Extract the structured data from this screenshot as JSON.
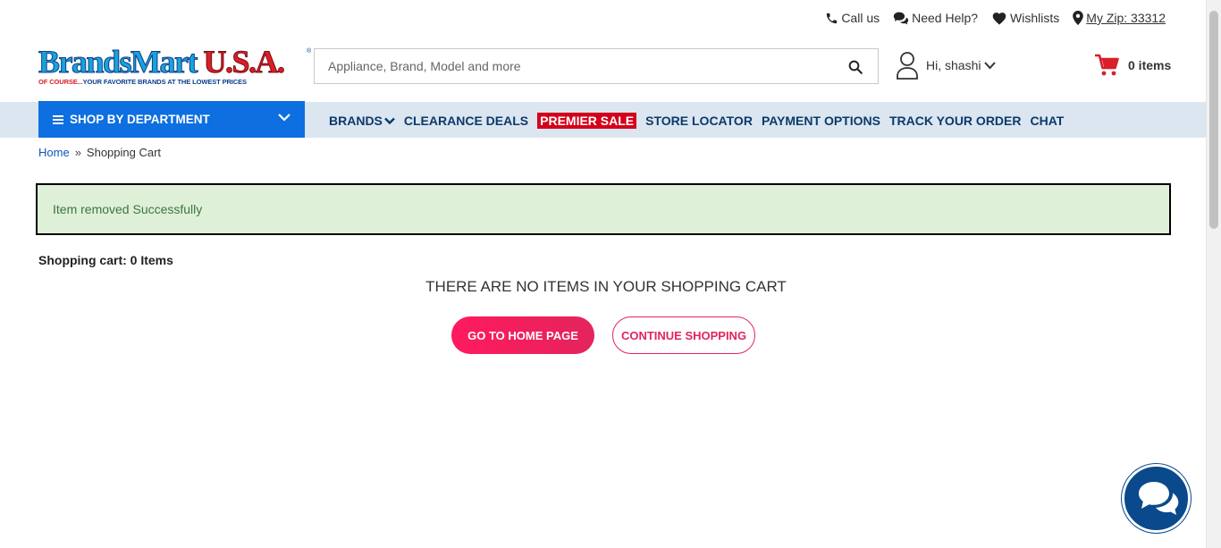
{
  "topbar": {
    "call_us": "Call us",
    "need_help": "Need Help?",
    "wishlists": "Wishlists",
    "zip": "My Zip: 33312"
  },
  "logo": {
    "word1": "BrandsMart",
    "word2": "U.S.A.",
    "tagline_red": "OF COURSE...",
    "tagline_rest": "YOUR FAVORITE BRANDS AT THE LOWEST PRICES"
  },
  "search": {
    "placeholder": "Appliance, Brand, Model and more",
    "value": ""
  },
  "account": {
    "greeting": "Hi, shashi"
  },
  "cart": {
    "count_label": "0 items"
  },
  "nav": {
    "shop_by_department": "SHOP BY DEPARTMENT",
    "links": [
      "BRANDS",
      "CLEARANCE DEALS",
      "PREMIER SALE",
      "STORE LOCATOR",
      "PAYMENT OPTIONS",
      "TRACK YOUR ORDER",
      "CHAT"
    ]
  },
  "breadcrumb": {
    "home": "Home",
    "separator": "»",
    "current": "Shopping Cart"
  },
  "alert": {
    "message": "Item removed Successfully"
  },
  "main": {
    "cart_count": "Shopping cart: 0 Items",
    "empty_message": "THERE ARE NO ITEMS IN YOUR SHOPPING CART",
    "go_home_label": "GO TO HOME PAGE",
    "continue_label": "CONTINUE SHOPPING"
  },
  "colors": {
    "nav_blue": "#0d6fe0",
    "nav_bg": "#dbe6f0",
    "nav_text": "#0c3a6b",
    "premier_red": "#d4001b",
    "accent_pink": "#e4245c",
    "alert_bg": "#dff0d8",
    "cart_red": "#d81f2a",
    "chat_blue": "#0a4a8c"
  },
  "icons": [
    "phone-icon",
    "chat-bubbles-icon",
    "heart-icon",
    "map-pin-icon",
    "search-icon",
    "user-icon",
    "chevron-down-icon",
    "cart-icon",
    "hamburger-icon",
    "live-chat-icon"
  ]
}
